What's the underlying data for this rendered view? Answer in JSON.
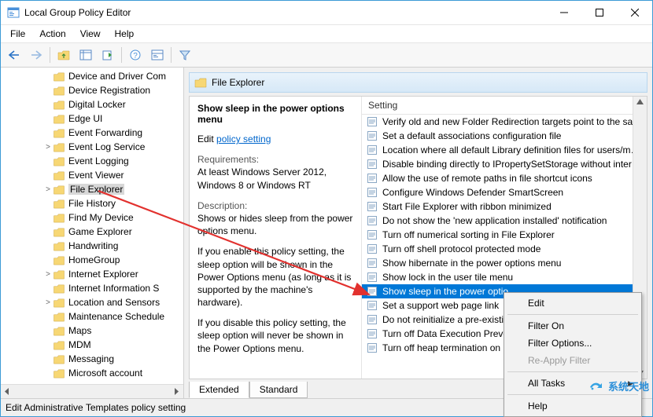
{
  "window": {
    "title": "Local Group Policy Editor"
  },
  "menu": [
    "File",
    "Action",
    "View",
    "Help"
  ],
  "tree": [
    {
      "label": "Device and Driver Com",
      "exp": ""
    },
    {
      "label": "Device Registration",
      "exp": ""
    },
    {
      "label": "Digital Locker",
      "exp": ""
    },
    {
      "label": "Edge UI",
      "exp": ""
    },
    {
      "label": "Event Forwarding",
      "exp": ""
    },
    {
      "label": "Event Log Service",
      "exp": ">"
    },
    {
      "label": "Event Logging",
      "exp": ""
    },
    {
      "label": "Event Viewer",
      "exp": ""
    },
    {
      "label": "File Explorer",
      "exp": ">",
      "selected": true
    },
    {
      "label": "File History",
      "exp": ""
    },
    {
      "label": "Find My Device",
      "exp": ""
    },
    {
      "label": "Game Explorer",
      "exp": ""
    },
    {
      "label": "Handwriting",
      "exp": ""
    },
    {
      "label": "HomeGroup",
      "exp": ""
    },
    {
      "label": "Internet Explorer",
      "exp": ">"
    },
    {
      "label": "Internet Information S",
      "exp": ""
    },
    {
      "label": "Location and Sensors",
      "exp": ">"
    },
    {
      "label": "Maintenance Schedule",
      "exp": ""
    },
    {
      "label": "Maps",
      "exp": ""
    },
    {
      "label": "MDM",
      "exp": ""
    },
    {
      "label": "Messaging",
      "exp": ""
    },
    {
      "label": "Microsoft account",
      "exp": ""
    }
  ],
  "panel": {
    "header": "File Explorer",
    "desc_title": "Show sleep in the power options menu",
    "edit_prefix": "Edit ",
    "edit_link": "policy setting",
    "req_hdr": "Requirements:",
    "req_body": "At least Windows Server 2012, Windows 8 or Windows RT",
    "dsc_hdr": "Description:",
    "dsc_body": "Shows or hides sleep from the power options menu.",
    "p1": "If you enable this policy setting, the sleep option will be shown in the Power Options menu (as long as it is supported by the machine's hardware).",
    "p2": "If you disable this policy setting, the sleep option will never be shown in the Power Options menu.",
    "col": "Setting"
  },
  "settings": [
    "Verify old and new Folder Redirection targets point to the sa…",
    "Set a default associations configuration file",
    "Location where all default Library definition files for users/m…",
    "Disable binding directly to IPropertySetStorage without inter…",
    "Allow the use of remote paths in file shortcut icons",
    "Configure Windows Defender SmartScreen",
    "Start File Explorer with ribbon minimized",
    "Do not show the 'new application installed' notification",
    "Turn off numerical sorting in File Explorer",
    "Turn off shell protocol protected mode",
    "Show hibernate in the power options menu",
    "Show lock in the user tile menu",
    "Show sleep in the power optio",
    "Set a support web page link",
    "Do not reinitialize a pre-existin",
    "Turn off Data Execution Preve",
    "Turn off heap termination on"
  ],
  "settings_selected_index": 12,
  "tabs": {
    "extended": "Extended",
    "standard": "Standard"
  },
  "context_menu": [
    {
      "label": "Edit",
      "type": "item"
    },
    {
      "type": "sep"
    },
    {
      "label": "Filter On",
      "type": "item"
    },
    {
      "label": "Filter Options...",
      "type": "item"
    },
    {
      "label": "Re-Apply Filter",
      "type": "item",
      "disabled": true
    },
    {
      "type": "sep"
    },
    {
      "label": "All Tasks",
      "type": "item",
      "sub": true
    },
    {
      "type": "sep"
    },
    {
      "label": "Help",
      "type": "item"
    }
  ],
  "status": "Edit Administrative Templates policy setting",
  "watermark": "系统天地"
}
